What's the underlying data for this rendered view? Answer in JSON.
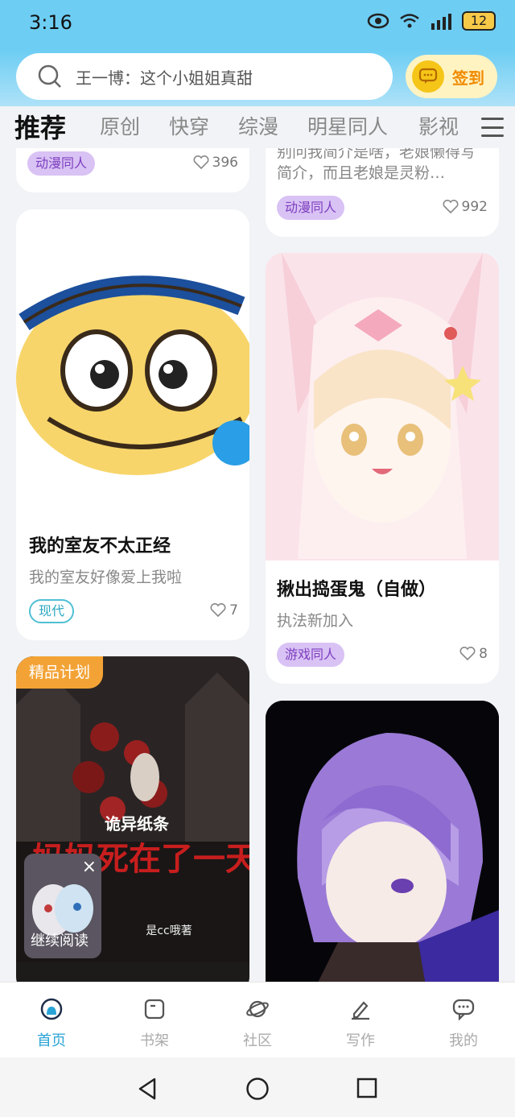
{
  "status_bar": {
    "time": "3:16",
    "battery": "12"
  },
  "search": {
    "placeholder": "王一博：这个小姐姐真甜"
  },
  "signin": {
    "label": "签到"
  },
  "tabs": [
    {
      "label": "推荐",
      "active": true
    },
    {
      "label": "原创"
    },
    {
      "label": "快穿"
    },
    {
      "label": "综漫"
    },
    {
      "label": "明星同人"
    },
    {
      "label": "影视"
    }
  ],
  "cards": {
    "top_left": {
      "tag": "动漫同人",
      "likes": "396"
    },
    "top_right": {
      "desc": "别问我简介是啥，老娘懒得写简介，而且老娘是灵粉…",
      "tag": "动漫同人",
      "likes": "992"
    },
    "card1": {
      "title": "我的室友不太正经",
      "desc": "我的室友好像爱上我啦",
      "tag": "现代",
      "likes": "7"
    },
    "card2": {
      "title": "揪出捣蛋鬼（自做）",
      "desc": "执法新加入",
      "tag": "游戏同人",
      "likes": "8"
    },
    "card3": {
      "badge": "精品计划",
      "cover_text_top": "诡异纸条",
      "cover_text_main": "妈妈死在了一天",
      "cover_author": "是cc哦著"
    },
    "card4": {}
  },
  "continue_reading": {
    "label": "继续阅读",
    "close": "×"
  },
  "bottom_nav": [
    {
      "label": "首页",
      "icon": "home-icon",
      "active": true
    },
    {
      "label": "书架",
      "icon": "bookshelf-icon"
    },
    {
      "label": "社区",
      "icon": "planet-icon"
    },
    {
      "label": "写作",
      "icon": "pen-icon"
    },
    {
      "label": "我的",
      "icon": "chat-bubble-icon"
    }
  ],
  "colors": {
    "accent": "#29a3d6",
    "header": "#6dcdf3",
    "badge": "#f3a336",
    "tag_purple": "#d9c2f4"
  }
}
